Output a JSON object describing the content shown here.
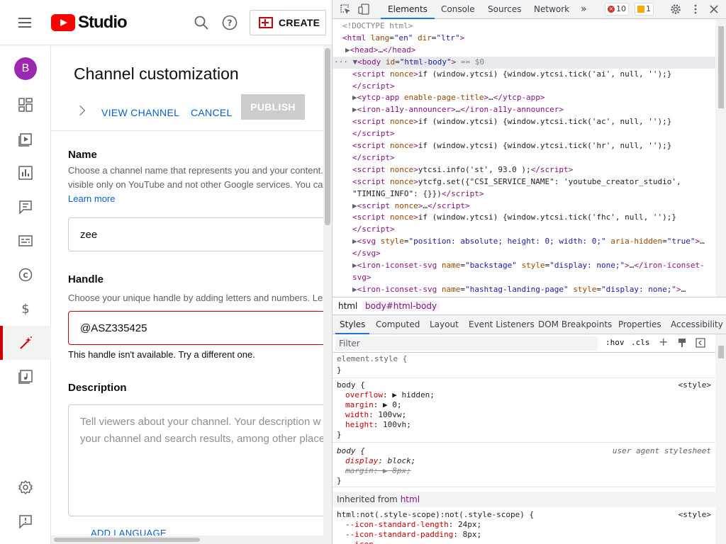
{
  "studio": {
    "logo_text": "Studio",
    "create_label": "CREATE",
    "avatar_letter": "B",
    "page_title": "Channel customization",
    "actions": {
      "view_channel": "VIEW CHANNEL",
      "cancel": "CANCEL",
      "publish": "PUBLISH"
    },
    "name_section": {
      "title": "Name",
      "desc_line1": "Choose a channel name that represents you and your content.",
      "desc_line2": "visible only on YouTube and not other Google services. You ca",
      "learn_more": "Learn more",
      "value": "zee"
    },
    "handle_section": {
      "title": "Handle",
      "desc": "Choose your unique handle by adding letters and numbers. Lea",
      "value": "@ASZ335425",
      "error": "This handle isn't available. Try a different one."
    },
    "description_section": {
      "title": "Description",
      "placeholder_line1": "Tell viewers about your channel. Your description w",
      "placeholder_line2": "your channel and search results, among other place"
    },
    "add_language": "ADD LANGUAGE"
  },
  "devtools": {
    "tabs": [
      "Elements",
      "Console",
      "Sources",
      "Network"
    ],
    "more_tabs": "»",
    "error_count": "10",
    "warning_count": "1",
    "dom_lines": [
      {
        "indent": 1,
        "html": "<span class='cm'>&lt;!DOCTYPE html&gt;</span>"
      },
      {
        "indent": 1,
        "html": "<span class='tg'>&lt;html</span> <span class='at'>lang</span>=<span class='av'>\"en\"</span> <span class='at'>dir</span>=<span class='av'>\"ltr\"</span><span class='tg'>&gt;</span>"
      },
      {
        "indent": 2,
        "html": "<span class='tri'>▶</span><span class='tg'>&lt;head&gt;</span>…<span class='tg'>&lt;/head&gt;</span>"
      },
      {
        "indent": 0,
        "html": "<span class='tri'>··· ▼</span><span class='tg'>&lt;body</span> <span class='at'>id</span>=<span class='av'>\"html-body\"</span><span class='tg'>&gt;</span> <span class='cm'>== $0</span>",
        "sel": true
      },
      {
        "indent": 3,
        "html": "<span class='tg'>&lt;script</span> <span class='at'>nonce</span><span class='tg'>&gt;</span>if (window.ytcsi) {window.ytcsi.tick('ai', null, '');}"
      },
      {
        "indent": 3,
        "html": "<span class='tg'>&lt;/script&gt;</span>"
      },
      {
        "indent": 3,
        "html": "<span class='tri'>▶</span><span class='tg'>&lt;ytcp-app</span> <span class='at'>enable-page-title</span><span class='tg'>&gt;</span>…<span class='tg'>&lt;/ytcp-app&gt;</span>"
      },
      {
        "indent": 3,
        "html": "<span class='tri'>▶</span><span class='tg'>&lt;iron-a11y-announcer&gt;</span>…<span class='tg'>&lt;/iron-a11y-announcer&gt;</span>"
      },
      {
        "indent": 3,
        "html": "<span class='tg'>&lt;script</span> <span class='at'>nonce</span><span class='tg'>&gt;</span>if (window.ytcsi) {window.ytcsi.tick('ac', null, '');}"
      },
      {
        "indent": 3,
        "html": "<span class='tg'>&lt;/script&gt;</span>"
      },
      {
        "indent": 3,
        "html": "<span class='tg'>&lt;script</span> <span class='at'>nonce</span><span class='tg'>&gt;</span>if (window.ytcsi) {window.ytcsi.tick('hr', null, '');}"
      },
      {
        "indent": 3,
        "html": "<span class='tg'>&lt;/script&gt;</span>"
      },
      {
        "indent": 3,
        "html": "<span class='tg'>&lt;script</span> <span class='at'>nonce</span><span class='tg'>&gt;</span>ytcsi.info('st', 93.0 );<span class='tg'>&lt;/script&gt;</span>"
      },
      {
        "indent": 3,
        "html": "<span class='tg'>&lt;script</span> <span class='at'>nonce</span><span class='tg'>&gt;</span>ytcfg.set({\"CSI_SERVICE_NAME\": 'youtube_creator_studio',"
      },
      {
        "indent": 3,
        "html": "\"TIMING_INFO\": {}})<span class='tg'>&lt;/script&gt;</span>"
      },
      {
        "indent": 3,
        "html": "<span class='tri'>▶</span><span class='tg'>&lt;script</span> <span class='at'>nonce</span><span class='tg'>&gt;</span>…<span class='tg'>&lt;/script&gt;</span>"
      },
      {
        "indent": 3,
        "html": "<span class='tg'>&lt;script</span> <span class='at'>nonce</span><span class='tg'>&gt;</span>if (window.ytcsi) {window.ytcsi.tick('fhc', null, '');}"
      },
      {
        "indent": 3,
        "html": "<span class='tg'>&lt;/script&gt;</span>"
      },
      {
        "indent": 3,
        "html": "<span class='tri'>▶</span><span class='tg'>&lt;svg</span> <span class='at'>style</span>=<span class='av'>\"position: absolute; height: 0; width: 0;\"</span> <span class='at'>aria-hidden</span>=<span class='av'>\"true\"</span><span class='tg'>&gt;</span>…"
      },
      {
        "indent": 3,
        "html": "<span class='tg'>&lt;/svg&gt;</span>"
      },
      {
        "indent": 3,
        "html": "<span class='tri'>▶</span><span class='tg'>&lt;iron-iconset-svg</span> <span class='at'>name</span>=<span class='av'>\"backstage\"</span> <span class='at'>style</span>=<span class='av'>\"display: none;\"</span><span class='tg'>&gt;</span>…<span class='tg'>&lt;/iron-iconset-</span>"
      },
      {
        "indent": 3,
        "html": "<span class='tg'>svg&gt;</span>"
      },
      {
        "indent": 3,
        "html": "<span class='tri'>▶</span><span class='tg'>&lt;iron-iconset-svg</span> <span class='at'>name</span>=<span class='av'>\"hashtag-landing-page\"</span> <span class='at'>style</span>=<span class='av'>\"display: none;\"</span><span class='tg'>&gt;</span>…"
      }
    ],
    "breadcrumbs": [
      "html",
      "body#html-body"
    ],
    "sub_tabs": [
      "Styles",
      "Computed",
      "Layout",
      "Event Listeners",
      "DOM Breakpoints",
      "Properties",
      "Accessibility"
    ],
    "filter_placeholder": "Filter",
    "filter_tools": {
      "hov": ":hov",
      "cls": ".cls",
      "plus": "+"
    },
    "inherited_label": "Inherited from",
    "inherited_tag": "html",
    "styles_source": "<style>",
    "ua_source": "user agent stylesheet"
  }
}
